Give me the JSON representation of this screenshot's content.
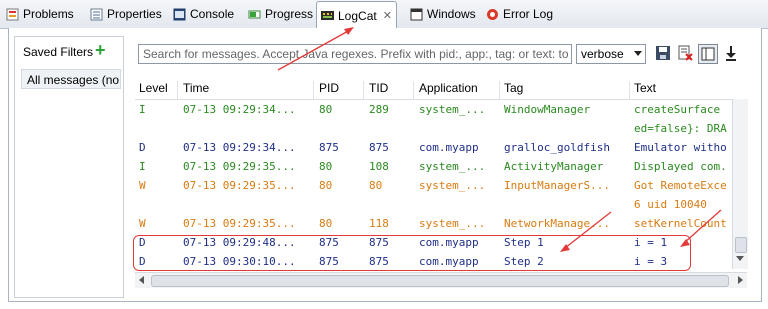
{
  "tabs": [
    {
      "label": "Problems",
      "icon": "problems-icon"
    },
    {
      "label": "Properties",
      "icon": "properties-icon"
    },
    {
      "label": "Console",
      "icon": "console-icon"
    },
    {
      "label": "Progress",
      "icon": "progress-icon"
    },
    {
      "label": "LogCat",
      "icon": "logcat-icon",
      "active": true
    },
    {
      "label": "Windows",
      "icon": "windows-icon"
    },
    {
      "label": "Error Log",
      "icon": "error-log-icon"
    }
  ],
  "saved_filters": {
    "title": "Saved Filters",
    "add_icon": "plus-icon",
    "items": [
      "All messages (no f"
    ]
  },
  "search": {
    "placeholder": "Search for messages. Accept Java regexes. Prefix with pid:, app:, tag: or text: to lir"
  },
  "log_level_select": {
    "value": "verbose"
  },
  "toolbar_icons": [
    "save-icon",
    "clear-log-icon",
    "toggle-view-icon",
    "scroll-lock-icon"
  ],
  "table": {
    "columns": [
      "Level",
      "Time",
      "PID",
      "TID",
      "Application",
      "Tag",
      "Text"
    ],
    "rows": [
      {
        "level": "I",
        "time": "07-13 09:29:34...",
        "pid": "80",
        "tid": "289",
        "app": "system_...",
        "tag": "WindowManager",
        "text": "createSurface",
        "kind": "info"
      },
      {
        "level": "",
        "time": "",
        "pid": "",
        "tid": "",
        "app": "",
        "tag": "",
        "text": "ed=false}: DRA",
        "kind": "info"
      },
      {
        "level": "D",
        "time": "07-13 09:29:34...",
        "pid": "875",
        "tid": "875",
        "app": "com.myapp",
        "tag": "gralloc_goldfish",
        "text": "Emulator witho",
        "kind": "debug"
      },
      {
        "level": "I",
        "time": "07-13 09:29:35...",
        "pid": "80",
        "tid": "108",
        "app": "system_...",
        "tag": "ActivityManager",
        "text": "Displayed com.",
        "kind": "info"
      },
      {
        "level": "W",
        "time": "07-13 09:29:35...",
        "pid": "80",
        "tid": "80",
        "app": "system_...",
        "tag": "InputManagerS...",
        "text": "Got RemoteExce",
        "kind": "warn"
      },
      {
        "level": "",
        "time": "",
        "pid": "",
        "tid": "",
        "app": "",
        "tag": "",
        "text": "6 uid 10040",
        "kind": "warn"
      },
      {
        "level": "W",
        "time": "07-13 09:29:35...",
        "pid": "80",
        "tid": "118",
        "app": "system_...",
        "tag": "NetworkManage...",
        "text": "setKernelCount",
        "kind": "warn"
      },
      {
        "level": "D",
        "time": "07-13 09:29:48...",
        "pid": "875",
        "tid": "875",
        "app": "com.myapp",
        "tag": "Step 1",
        "text": "i = 1",
        "kind": "debug"
      },
      {
        "level": "D",
        "time": "07-13 09:30:10...",
        "pid": "875",
        "tid": "875",
        "app": "com.myapp",
        "tag": "Step 2",
        "text": "i = 3",
        "kind": "debug"
      }
    ]
  },
  "colors": {
    "info": "#2a8a1f",
    "debug": "#1f2f86",
    "warn": "#d87b12",
    "annotation": "#e23a3a",
    "add": "#29a335"
  }
}
